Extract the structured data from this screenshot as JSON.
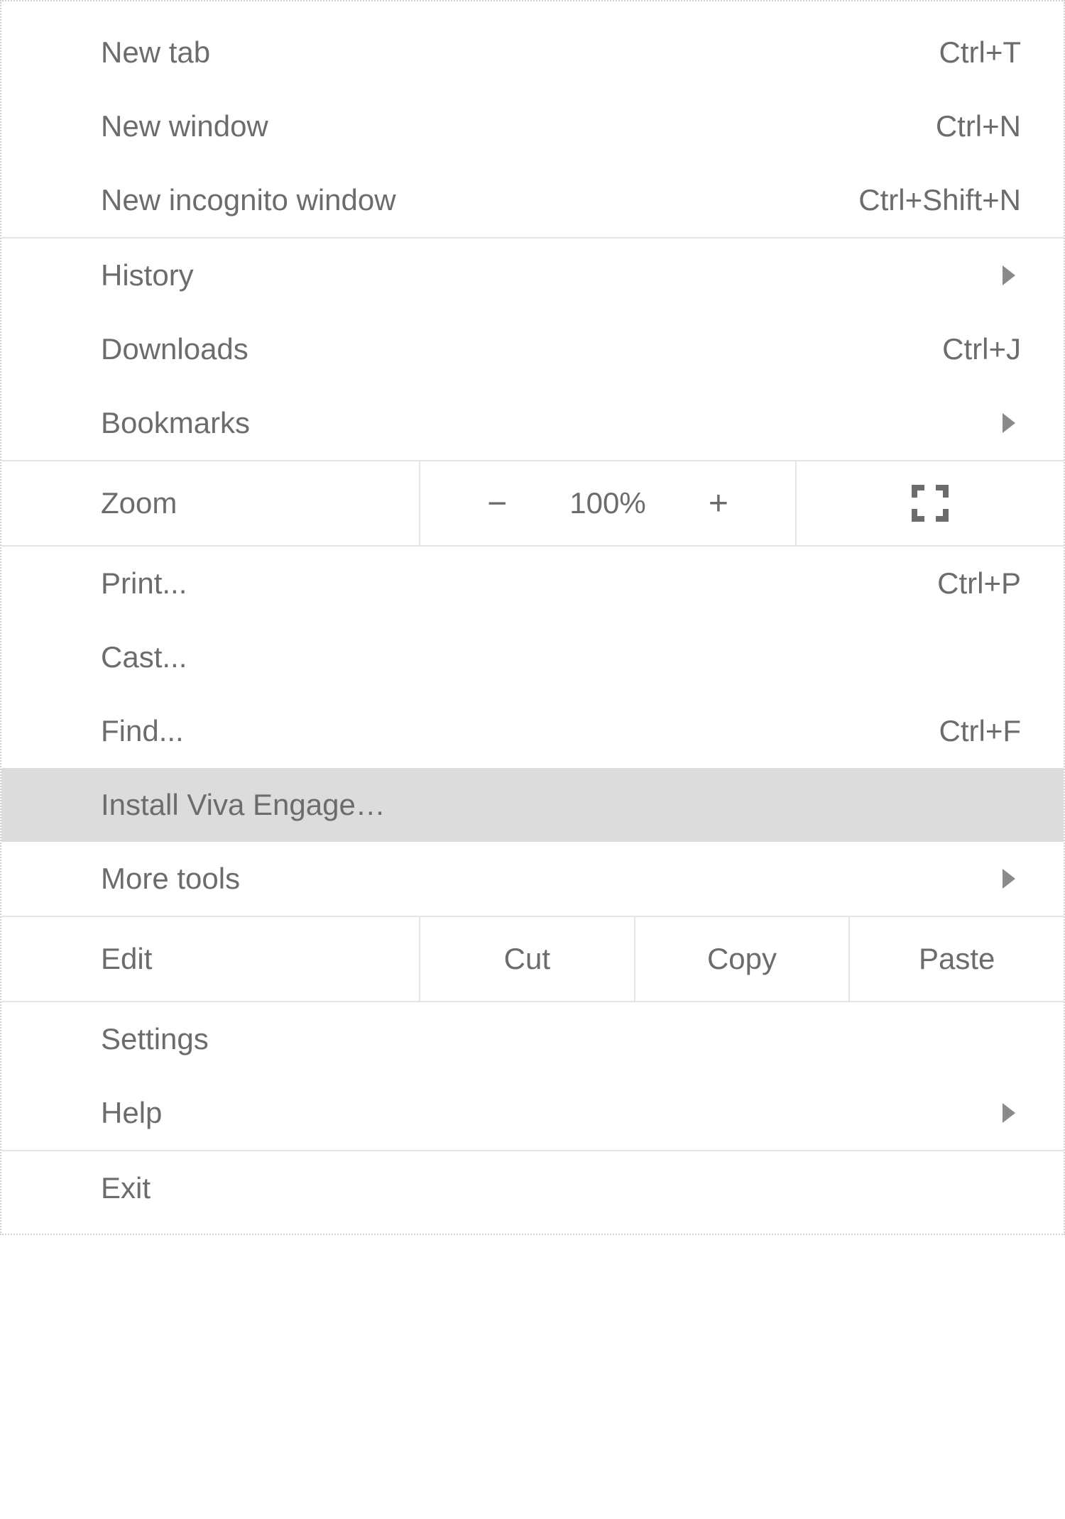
{
  "menu": {
    "section1": {
      "newTab": {
        "label": "New tab",
        "shortcut": "Ctrl+T"
      },
      "newWindow": {
        "label": "New window",
        "shortcut": "Ctrl+N"
      },
      "newIncognito": {
        "label": "New incognito window",
        "shortcut": "Ctrl+Shift+N"
      }
    },
    "section2": {
      "history": {
        "label": "History"
      },
      "downloads": {
        "label": "Downloads",
        "shortcut": "Ctrl+J"
      },
      "bookmarks": {
        "label": "Bookmarks"
      }
    },
    "zoom": {
      "label": "Zoom",
      "minus": "−",
      "value": "100%",
      "plus": "+"
    },
    "section4": {
      "print": {
        "label": "Print...",
        "shortcut": "Ctrl+P"
      },
      "cast": {
        "label": "Cast..."
      },
      "find": {
        "label": "Find...",
        "shortcut": "Ctrl+F"
      },
      "install": {
        "label": "Install Viva Engage…"
      },
      "moreTools": {
        "label": "More tools"
      }
    },
    "edit": {
      "label": "Edit",
      "cut": "Cut",
      "copy": "Copy",
      "paste": "Paste"
    },
    "section6": {
      "settings": {
        "label": "Settings"
      },
      "help": {
        "label": "Help"
      }
    },
    "section7": {
      "exit": {
        "label": "Exit"
      }
    }
  }
}
